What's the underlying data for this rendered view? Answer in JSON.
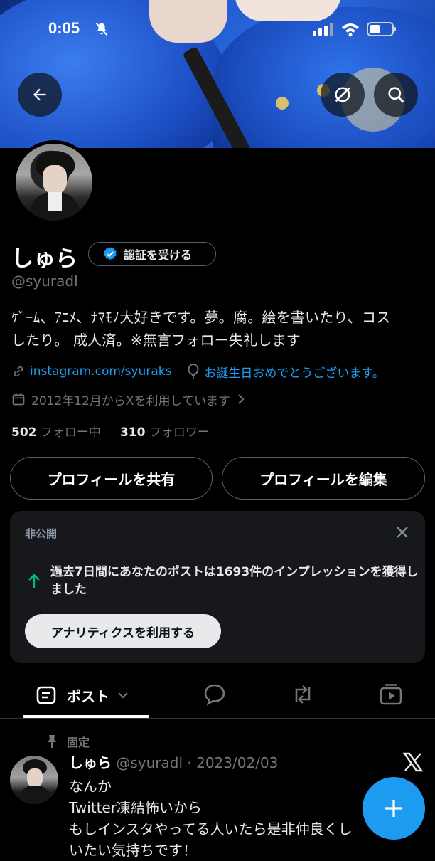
{
  "status_bar": {
    "time": "0:05"
  },
  "profile": {
    "name": "しゅら",
    "verify_label": "認証を受ける",
    "handle": "@syuradl",
    "bio_line1": "ｹﾞｰﾑ、ｱﾆﾒ、ﾅﾏﾓﾉ大好きです。夢。腐。絵を書いたり、コス",
    "bio_line2": "したり。 成人済。※無言フォロー失礼します",
    "link": "instagram.com/syuraks",
    "birthday": "お誕生日おめでとうございます。",
    "joined": "2012年12月からXを利用しています",
    "following_count": "502",
    "following_label": "フォロー中",
    "followers_count": "310",
    "followers_label": "フォロワー"
  },
  "actions": {
    "share_label": "プロフィールを共有",
    "edit_label": "プロフィールを編集"
  },
  "private_card": {
    "label": "非公開",
    "message": "過去7日間にあなたのポストは1693件のインプレッションを獲得しました",
    "button": "アナリティクスを利用する",
    "accent": "#00ba7c"
  },
  "tabs": {
    "posts_label": "ポスト",
    "icons": [
      "posts-icon",
      "replies-icon",
      "reposts-icon",
      "media-icon"
    ]
  },
  "pinned_post": {
    "pinned_label": "固定",
    "author_name": "しゅら",
    "author_meta": "@syuradl · 2023/02/03",
    "lines": [
      "なんか",
      "Twitter凍結怖いから",
      "もしインスタやってる人いたら是非仲良くし",
      "いたい気持ちです！"
    ]
  },
  "colors": {
    "accent": "#1d9bf0",
    "background": "#000000",
    "card": "#16181c"
  }
}
